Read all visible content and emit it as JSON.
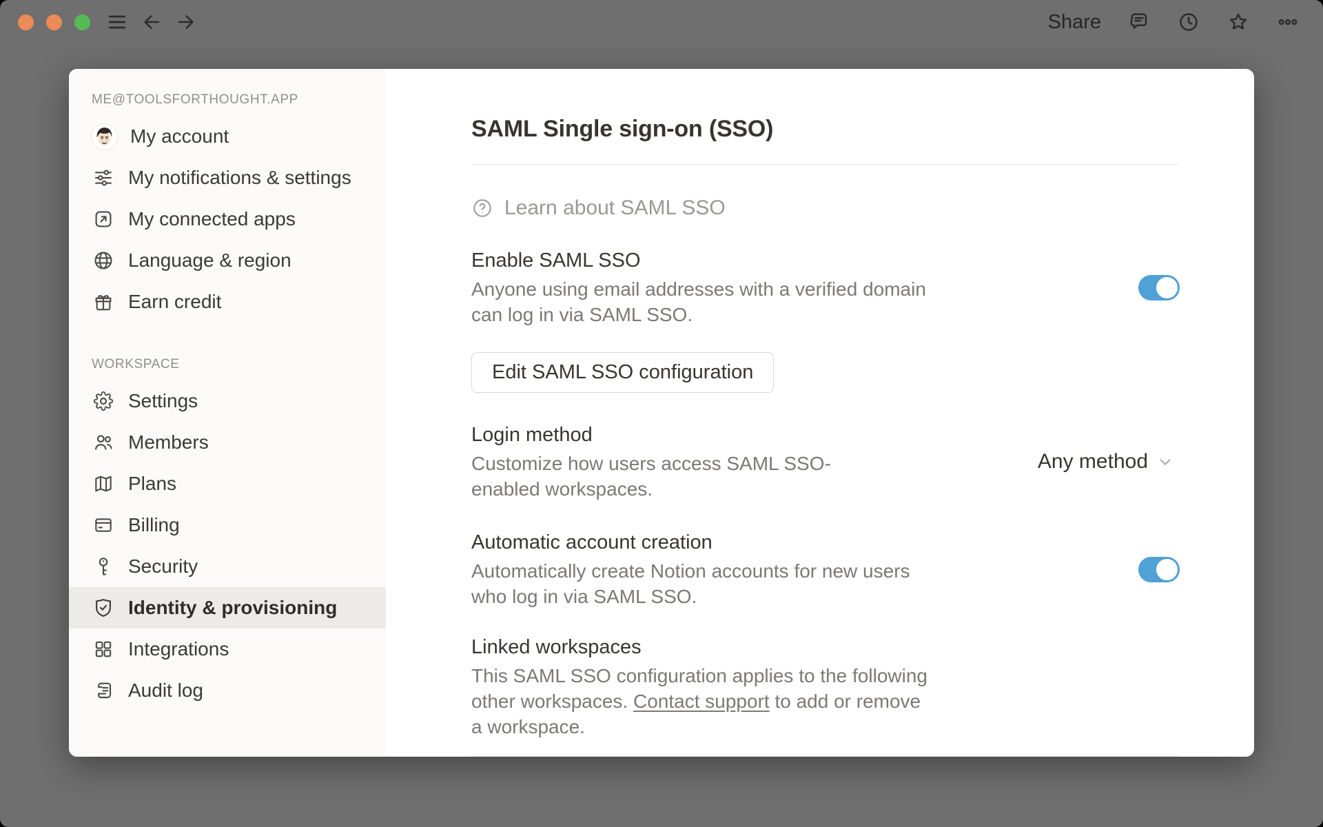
{
  "titlebar": {
    "share_label": "Share",
    "traffic_lights": [
      "close",
      "minimize",
      "zoom"
    ],
    "icons": [
      "hamburger-icon",
      "back-arrow-icon",
      "forward-arrow-icon",
      "comment-icon",
      "history-clock-icon",
      "star-icon",
      "ellipsis-icon"
    ]
  },
  "sidebar": {
    "account_section_label": "ME@TOOLSFORTHOUGHT.APP",
    "account_items": [
      {
        "label": "My account",
        "icon": "avatar"
      },
      {
        "label": "My notifications & settings",
        "icon": "sliders-icon"
      },
      {
        "label": "My connected apps",
        "icon": "arrow-up-right-square-icon"
      },
      {
        "label": "Language & region",
        "icon": "globe-icon"
      },
      {
        "label": "Earn credit",
        "icon": "gift-icon"
      }
    ],
    "workspace_section_label": "WORKSPACE",
    "workspace_items": [
      {
        "label": "Settings",
        "icon": "gear-icon",
        "selected": false
      },
      {
        "label": "Members",
        "icon": "members-icon",
        "selected": false
      },
      {
        "label": "Plans",
        "icon": "map-icon",
        "selected": false
      },
      {
        "label": "Billing",
        "icon": "credit-card-icon",
        "selected": false
      },
      {
        "label": "Security",
        "icon": "key-icon",
        "selected": false
      },
      {
        "label": "Identity & provisioning",
        "icon": "shield-check-icon",
        "selected": true
      },
      {
        "label": "Integrations",
        "icon": "grid-icon",
        "selected": false
      },
      {
        "label": "Audit log",
        "icon": "scroll-icon",
        "selected": false
      }
    ]
  },
  "main": {
    "title": "SAML Single sign-on (SSO)",
    "learn_link": "Learn about SAML SSO",
    "enable_saml": {
      "title": "Enable SAML SSO",
      "description": "Anyone using email addresses with a verified domain can log in via SAML SSO.",
      "toggle_on": true
    },
    "edit_button_label": "Edit SAML SSO configuration",
    "login_method": {
      "title": "Login method",
      "description": "Customize how users access SAML SSO-enabled workspaces.",
      "selected_option": "Any method"
    },
    "auto_account": {
      "title": "Automatic account creation",
      "description": "Automatically create Notion accounts for new users who log in via SAML SSO.",
      "toggle_on": true
    },
    "linked_workspaces": {
      "title": "Linked workspaces",
      "description_before": "This SAML SSO configuration applies to the following other workspaces. ",
      "link_text": "Contact support",
      "description_after": " to add or remove a workspace."
    }
  },
  "colors": {
    "toggle_on": "#4FA1D6",
    "traffic_close": "#ED8B57",
    "traffic_minimize": "#ED8B57",
    "traffic_zoom": "#55BC55",
    "backdrop": "#6F6F6F",
    "sidebar_bg": "#FBFAF9",
    "selected_item_bg": "#ECEBE8"
  }
}
